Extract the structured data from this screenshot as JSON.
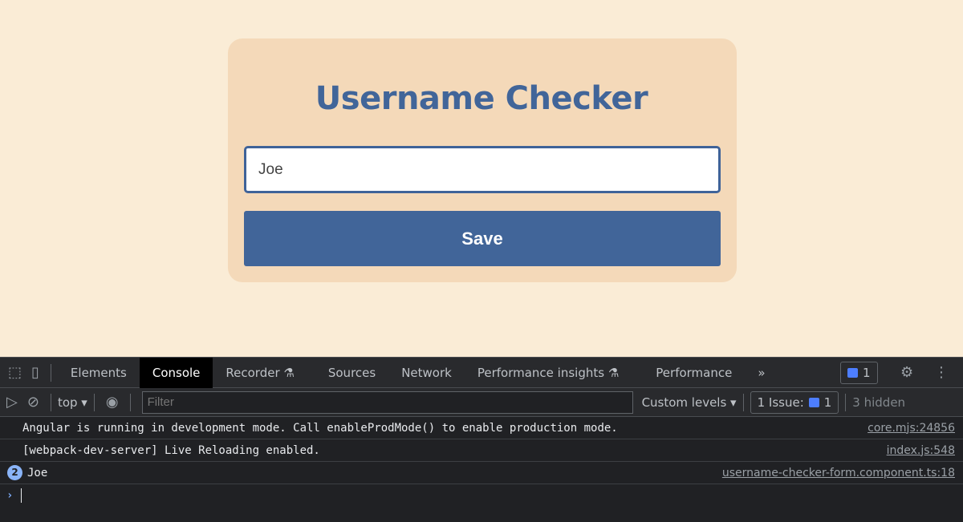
{
  "app": {
    "title": "Username Checker",
    "input_value": "Joe",
    "save_label": "Save",
    "colors": {
      "background": "#faecd6",
      "card": "#f4d9b9",
      "accent": "#416599"
    }
  },
  "devtools": {
    "tabs": [
      {
        "label": "Elements"
      },
      {
        "label": "Console",
        "active": true
      },
      {
        "label": "Recorder",
        "icon": "flask-icon"
      },
      {
        "label": "Sources"
      },
      {
        "label": "Network"
      },
      {
        "label": "Performance insights",
        "icon": "flask-icon"
      },
      {
        "label": "Performance"
      }
    ],
    "more_tabs": "»",
    "messages_badge": "1",
    "toolbar": {
      "context": "top",
      "filter_placeholder": "Filter",
      "levels": "Custom levels",
      "issues_label": "1 Issue:",
      "issues_count": "1",
      "hidden": "3 hidden"
    },
    "console": [
      {
        "text": "Angular is running in development mode. Call enableProdMode() to enable production mode.",
        "source": "core.mjs:24856"
      },
      {
        "text": "[webpack-dev-server] Live Reloading enabled.",
        "source": "index.js:548"
      },
      {
        "count": "2",
        "text": "Joe",
        "source": "username-checker-form.component.ts:18"
      }
    ],
    "prompt": "›"
  }
}
